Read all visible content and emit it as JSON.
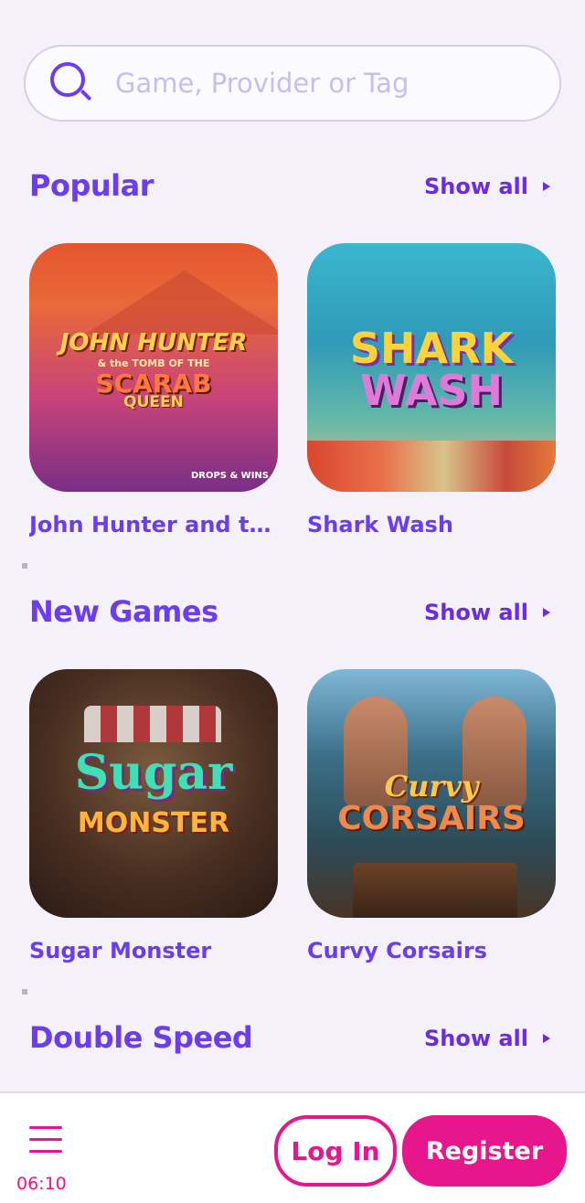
{
  "search": {
    "placeholder": "Game, Provider or Tag"
  },
  "sections": [
    {
      "title": "Popular",
      "show_all": "Show all",
      "games": [
        {
          "name": "John Hunter and the Tomb of the Scarab Queen",
          "logo": [
            "JOHN HUNTER",
            "& the TOMB OF THE",
            "SCARAB",
            "QUEEN"
          ],
          "badge": "DROPS & WINS"
        },
        {
          "name": "Shark Wash",
          "logo": [
            "SHARK",
            "WASH"
          ]
        }
      ]
    },
    {
      "title": "New Games",
      "show_all": "Show all",
      "games": [
        {
          "name": "Sugar Monster",
          "logo": [
            "Sugar",
            "MONSTER"
          ]
        },
        {
          "name": "Curvy Corsairs",
          "logo": [
            "Curvy",
            "CORSAIRS"
          ]
        }
      ]
    },
    {
      "title": "Double Speed",
      "show_all": "Show all"
    }
  ],
  "bottom_bar": {
    "time": "06:10",
    "login_label": "Log In",
    "register_label": "Register"
  },
  "colors": {
    "primary": "#6b3cf0",
    "accent": "#e8168c",
    "background": "#f4f1fa"
  }
}
